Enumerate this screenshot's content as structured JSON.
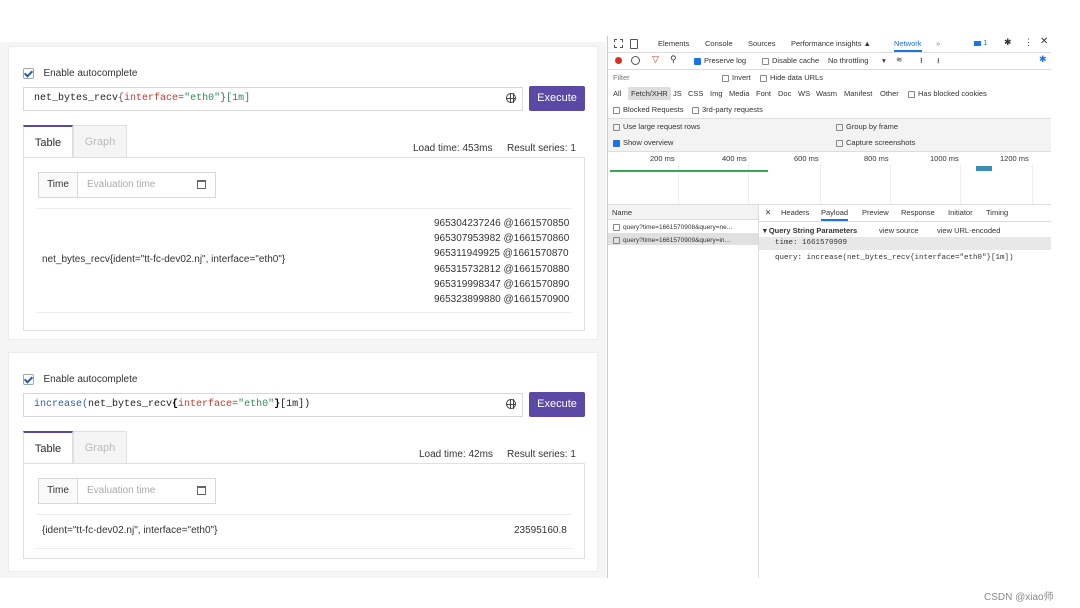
{
  "panel1": {
    "autocomplete_label": "Enable autocomplete",
    "query": {
      "metric": "net_bytes_recv",
      "open": "{",
      "label_key": "interface",
      "eq": "=",
      "label_val": "\"eth0\"",
      "close": "}",
      "range": "[1m]"
    },
    "execute_label": "Execute",
    "tabs": [
      "Table",
      "Graph"
    ],
    "load_time": "Load time: 453ms",
    "result_series": "Result series: 1",
    "time_label": "Time",
    "eval_placeholder": "Evaluation time",
    "series_name": "net_bytes_recv{ident=\"tt-fc-dev02.nj\", interface=\"eth0\"}",
    "values": [
      "965304237246 @1661570850",
      "965307953982 @1661570860",
      "965311949925 @1661570870",
      "965315732812 @1661570880",
      "965319998347 @1661570890",
      "965323899880 @1661570900"
    ]
  },
  "panel2": {
    "autocomplete_label": "Enable autocomplete",
    "query": {
      "fn": "increase(",
      "metric": "net_bytes_recv",
      "open": "{",
      "label_key": "interface",
      "eq": "=",
      "label_val": "\"eth0\"",
      "close": "}",
      "range": "[1m])"
    },
    "execute_label": "Execute",
    "tabs": [
      "Table",
      "Graph"
    ],
    "load_time": "Load time: 42ms",
    "result_series": "Result series: 1",
    "time_label": "Time",
    "eval_placeholder": "Evaluation time",
    "series_name": "{ident=\"tt-fc-dev02.nj\", interface=\"eth0\"}",
    "value": "23595160.8"
  },
  "devtools": {
    "tabs": [
      "Elements",
      "Console",
      "Sources",
      "Performance insights ▲",
      "Network",
      "»"
    ],
    "badge": "1",
    "preserve_log": "Preserve log",
    "disable_cache": "Disable cache",
    "throttling": "No throttling",
    "filter_placeholder": "Filter",
    "invert": "Invert",
    "hide_data_urls": "Hide data URLs",
    "types": [
      "All",
      "Fetch/XHR",
      "JS",
      "CSS",
      "Img",
      "Media",
      "Font",
      "Doc",
      "WS",
      "Wasm",
      "Manifest",
      "Other"
    ],
    "has_blocked_cookies": "Has blocked cookies",
    "blocked_requests": "Blocked Requests",
    "third_party": "3rd-party requests",
    "large_rows": "Use large request rows",
    "group_by_frame": "Group by frame",
    "show_overview": "Show overview",
    "capture_screenshots": "Capture screenshots",
    "timeline_ticks": [
      "200 ms",
      "400 ms",
      "600 ms",
      "800 ms",
      "1000 ms",
      "1200 ms"
    ],
    "name_header": "Name",
    "requests": [
      "query?time=1661570908&query=ne...",
      "query?time=1661570909&query=in..."
    ],
    "detail_tabs": [
      "Headers",
      "Payload",
      "Preview",
      "Response",
      "Initiator",
      "Timing"
    ],
    "qsp_title": "▾ Query String Parameters",
    "view_source": "view source",
    "view_url_encoded": "view URL-encoded",
    "param_time": "time: 1661570909",
    "param_query": "query: increase(net_bytes_recv{interface=\"eth0\"}[1m])"
  },
  "watermark": "CSDN @xiao师",
  "colors": {
    "accent": "#5a4aa6",
    "label_key": "#c0392b",
    "label_val": "#2e8b57",
    "metric": "#222222",
    "devtools_blue": "#1a73e8"
  }
}
